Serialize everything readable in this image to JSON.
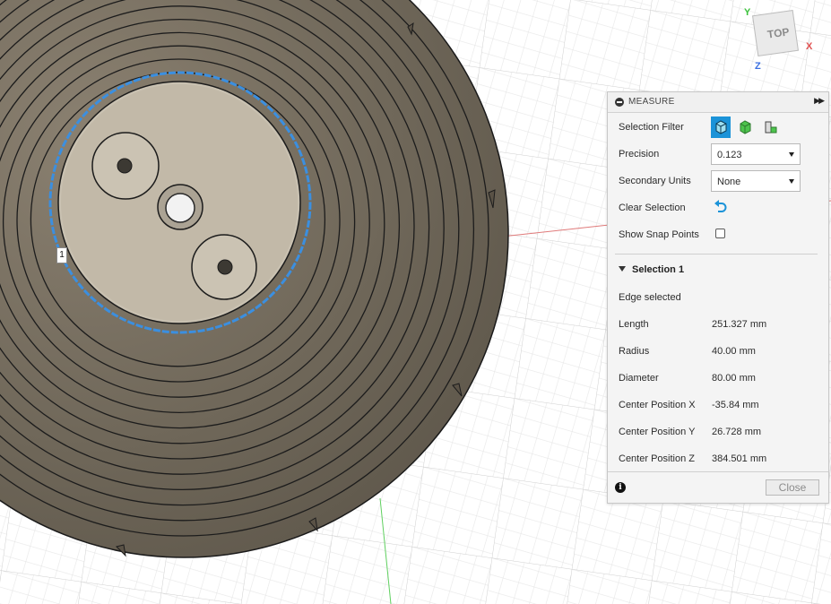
{
  "measure": {
    "title": "MEASURE",
    "selection_filter_label": "Selection Filter",
    "precision_label": "Precision",
    "precision_value": "0.123",
    "secondary_units_label": "Secondary Units",
    "secondary_units_value": "None",
    "clear_selection_label": "Clear Selection",
    "show_snap_points_label": "Show Snap Points",
    "show_snap_points_checked": false,
    "selection_title": "Selection 1",
    "selection_status": "Edge selected",
    "results": [
      {
        "label": "Length",
        "value": "251.327 mm"
      },
      {
        "label": "Radius",
        "value": "40.00 mm"
      },
      {
        "label": "Diameter",
        "value": "80.00 mm"
      },
      {
        "label": "Center Position X",
        "value": "-35.84 mm"
      },
      {
        "label": "Center Position Y",
        "value": "26.728 mm"
      },
      {
        "label": "Center Position Z",
        "value": "384.501 mm"
      }
    ],
    "close_label": "Close",
    "icons": [
      "collapse-icon",
      "expand-arrows-icon",
      "body-filter-icon",
      "face-filter-icon",
      "edge-filter-icon",
      "undo-arrow-icon",
      "info-icon"
    ]
  },
  "viewcube": {
    "face_label": "TOP",
    "axis_x": "X",
    "axis_y": "Y",
    "axis_z": "Z"
  },
  "viewport": {
    "selection_marker": "1"
  },
  "colors": {
    "accent": "#1b93d8",
    "selection_highlight": "#3b8fe0",
    "model": "#6e6557",
    "axis_x": "#e05050",
    "axis_y": "#3cc33c",
    "axis_z": "#3b6fe0"
  }
}
